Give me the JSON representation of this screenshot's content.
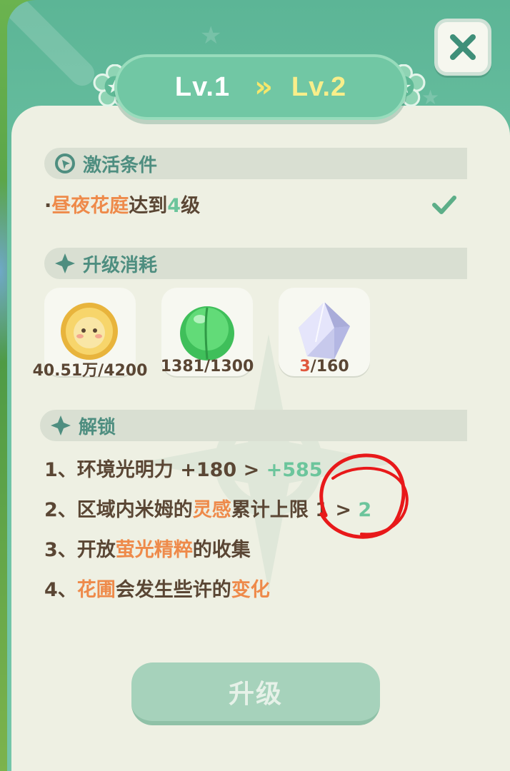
{
  "level": {
    "from": "Lv.1",
    "arrow": "»",
    "to": "Lv.2"
  },
  "activation": {
    "title": "激活条件",
    "condition": {
      "prefix": "·",
      "place": "昼夜花庭",
      "text1": "达到",
      "level": "4",
      "text2": "级"
    }
  },
  "cost": {
    "title": "升级消耗",
    "items": [
      {
        "icon": "gold-coin-icon",
        "have": "40.51万",
        "need": "/4200"
      },
      {
        "icon": "green-peach-icon",
        "have": "1381",
        "need": "/1300"
      },
      {
        "icon": "crystal-icon",
        "have": "3",
        "need": "/160"
      }
    ]
  },
  "unlock": {
    "title": "解锁",
    "lines": [
      {
        "n": "1、",
        "a": "环境光明力 +180 > ",
        "b": "+585"
      },
      {
        "n": "2、",
        "a": "区域内米姆的",
        "hl": "灵感",
        "c": "累计上限 1 > ",
        "b": "2"
      },
      {
        "n": "3、",
        "a": "开放",
        "hl": "萤光精粹",
        "c": "的收集"
      },
      {
        "n": "4、",
        "hl": "花圃",
        "a": "会发生些许的",
        "hl2": "变化"
      }
    ]
  },
  "upgrade_button": "升级",
  "colors": {
    "accent_green": "#6cc59c",
    "highlight_orange": "#ee8a4a",
    "insufficient_red": "#e0583e",
    "level_yellow": "#f8ee8a",
    "annotation_red": "#e8191a"
  }
}
